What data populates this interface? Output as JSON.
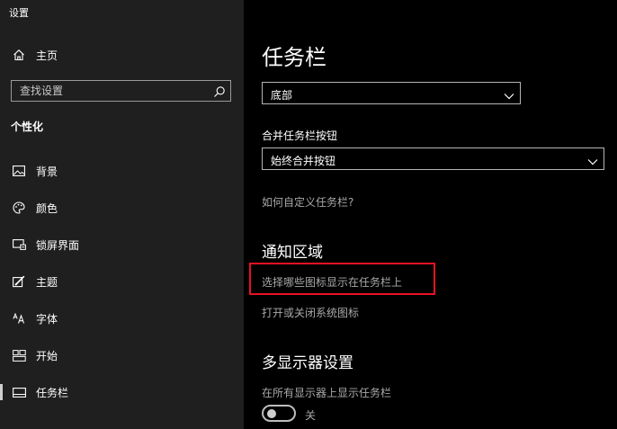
{
  "window": {
    "title": "设置"
  },
  "sidebar": {
    "home_label": "主页",
    "search_placeholder": "查找设置",
    "section_label": "个性化",
    "items": [
      {
        "label": "背景",
        "icon": "picture-icon"
      },
      {
        "label": "颜色",
        "icon": "palette-icon"
      },
      {
        "label": "锁屏界面",
        "icon": "lock-screen-icon"
      },
      {
        "label": "主题",
        "icon": "theme-brush-icon"
      },
      {
        "label": "字体",
        "icon": "font-icon"
      },
      {
        "label": "开始",
        "icon": "start-icon"
      },
      {
        "label": "任务栏",
        "icon": "taskbar-icon",
        "active": true
      }
    ]
  },
  "main": {
    "title": "任务栏",
    "position_select": {
      "value": "底部"
    },
    "combine_label": "合并任务栏按钮",
    "combine_select": {
      "value": "始终合并按钮"
    },
    "customize_link": "如何自定义任务栏?",
    "notification_header": "通知区域",
    "notification_links": [
      "选择哪些图标显示在任务栏上",
      "打开或关闭系统图标"
    ],
    "multi_display_header": "多显示器设置",
    "multi_display_option": "在所有显示器上显示任务栏",
    "multi_display_toggle": {
      "state": "关",
      "on": false
    }
  },
  "colors": {
    "sidebar_bg": "#1f1f1f",
    "main_bg": "#000000",
    "highlight": "#e81123",
    "active_indicator": "#cfcfcf"
  }
}
